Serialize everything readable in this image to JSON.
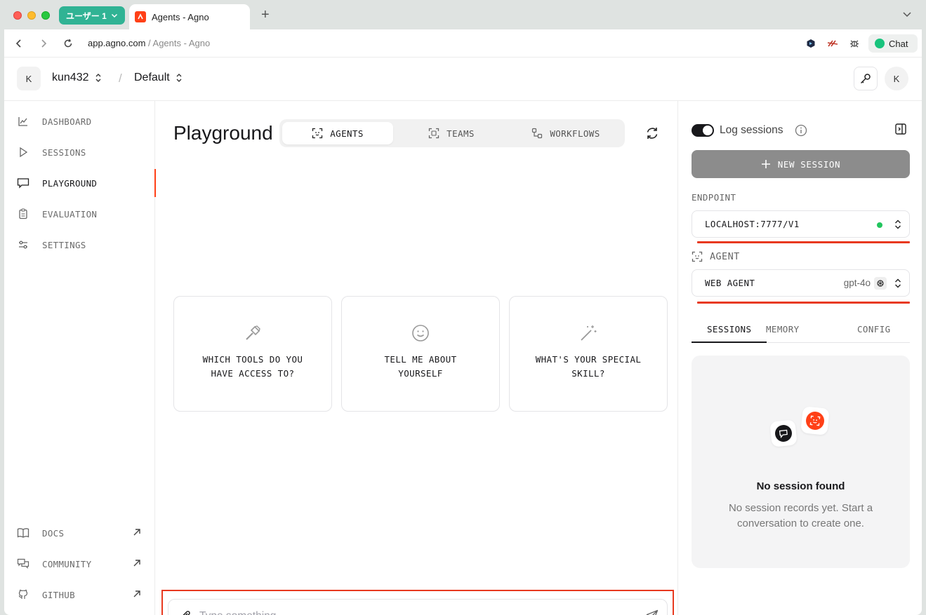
{
  "browser": {
    "profile_label": "ユーザー 1",
    "tab_title": "Agents - Agno",
    "url_host": "app.agno.com",
    "url_path": " / Agents - Agno",
    "chat_label": "Chat"
  },
  "header": {
    "org_initial": "K",
    "org_name": "kun432",
    "separator": "/",
    "workspace": "Default",
    "user_initial": "K"
  },
  "sidebar": {
    "items": [
      {
        "label": "DASHBOARD",
        "icon": "chart-line-icon"
      },
      {
        "label": "SESSIONS",
        "icon": "play-icon"
      },
      {
        "label": "PLAYGROUND",
        "icon": "message-square-icon",
        "active": true
      },
      {
        "label": "EVALUATION",
        "icon": "clipboard-icon"
      },
      {
        "label": "SETTINGS",
        "icon": "sliders-icon"
      }
    ],
    "bottom": [
      {
        "label": "DOCS",
        "icon": "book-icon"
      },
      {
        "label": "COMMUNITY",
        "icon": "messages-icon"
      },
      {
        "label": "GITHUB",
        "icon": "github-icon"
      }
    ]
  },
  "main": {
    "title": "Playground",
    "tabs": [
      {
        "label": "AGENTS",
        "active": true
      },
      {
        "label": "TEAMS"
      },
      {
        "label": "WORKFLOWS"
      }
    ],
    "suggestions": [
      {
        "text": "WHICH TOOLS DO YOU HAVE ACCESS TO?",
        "icon": "hammer-icon"
      },
      {
        "text": "TELL ME ABOUT YOURSELF",
        "icon": "smile-icon"
      },
      {
        "text": "WHAT'S YOUR SPECIAL SKILL?",
        "icon": "wand-sparkles-icon"
      }
    ],
    "input_placeholder": "Type something..."
  },
  "right": {
    "log_sessions_label": "Log sessions",
    "log_sessions_on": true,
    "new_session_label": "NEW SESSION",
    "endpoint_label": "ENDPOINT",
    "endpoint_value": "LOCALHOST:7777/V1",
    "endpoint_status_color": "#22c55e",
    "agent_label": "AGENT",
    "agent_value": "WEB AGENT",
    "agent_model": "gpt-4o",
    "tabs": [
      {
        "label": "SESSIONS",
        "active": true
      },
      {
        "label": "MEMORY"
      },
      {
        "label": "CONFIG"
      }
    ],
    "empty_title": "No session found",
    "empty_desc": "No session records yet. Start a conversation to create one."
  },
  "colors": {
    "accent": "#ff4017",
    "highlight": "#e8391f",
    "profile": "#30b394"
  }
}
